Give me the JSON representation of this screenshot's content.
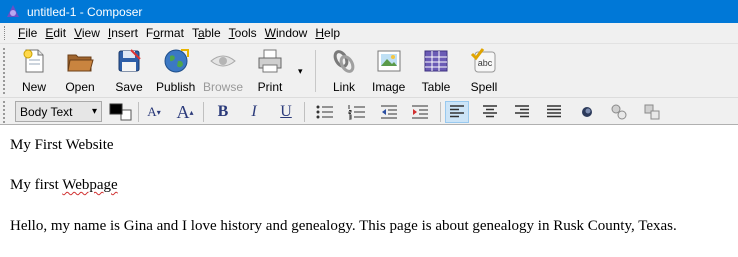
{
  "window": {
    "title": "untitled-1 - Composer"
  },
  "menu": {
    "items": [
      {
        "pre": "",
        "mn": "F",
        "post": "ile"
      },
      {
        "pre": "",
        "mn": "E",
        "post": "dit"
      },
      {
        "pre": "",
        "mn": "V",
        "post": "iew"
      },
      {
        "pre": "",
        "mn": "I",
        "post": "nsert"
      },
      {
        "pre": "F",
        "mn": "o",
        "post": "rmat"
      },
      {
        "pre": "T",
        "mn": "a",
        "post": "ble"
      },
      {
        "pre": "",
        "mn": "T",
        "post": "ools"
      },
      {
        "pre": "",
        "mn": "W",
        "post": "indow"
      },
      {
        "pre": "",
        "mn": "H",
        "post": "elp"
      }
    ]
  },
  "toolbar": {
    "new": "New",
    "open": "Open",
    "save": "Save",
    "publish": "Publish",
    "browse": "Browse",
    "print": "Print",
    "link": "Link",
    "image": "Image",
    "table": "Table",
    "spell": "Spell",
    "spell_icon_text": "abc"
  },
  "format": {
    "paragraph_style": "Body Text",
    "text_color": "#000000",
    "bold": "B",
    "italic": "I",
    "underline": "U",
    "larger": "A",
    "smaller": "A"
  },
  "document": {
    "line1": "My First Website",
    "line2_a": "My first ",
    "line2_b": "Webpage",
    "line3": "Hello, my name is Gina and I love history and genealogy. This page is about genealogy in Rusk County, Texas."
  }
}
